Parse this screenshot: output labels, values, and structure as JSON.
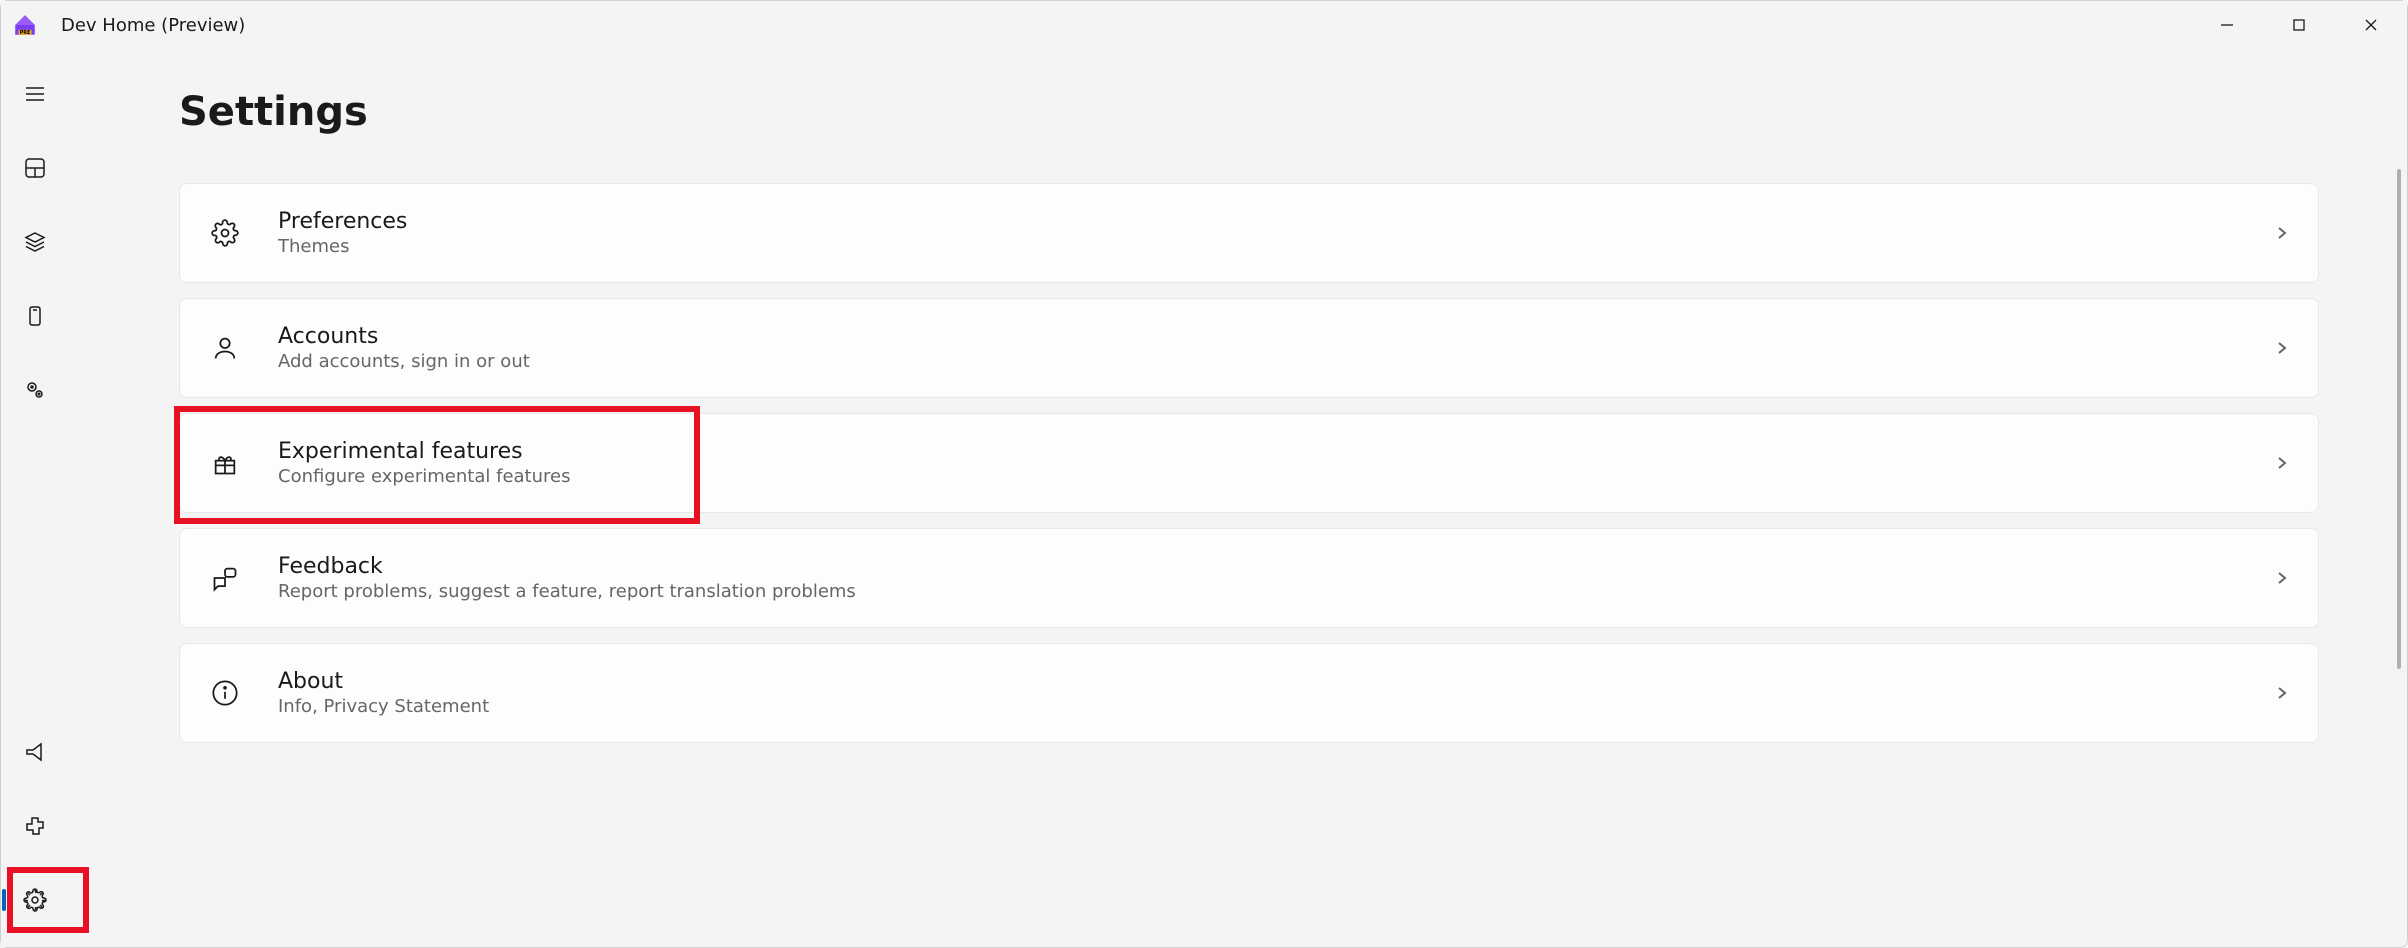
{
  "app": {
    "title": "Dev Home (Preview)"
  },
  "page": {
    "title": "Settings"
  },
  "cards": [
    {
      "id": "preferences",
      "title": "Preferences",
      "subtitle": "Themes",
      "icon": "gear"
    },
    {
      "id": "accounts",
      "title": "Accounts",
      "subtitle": "Add accounts, sign in or out",
      "icon": "person"
    },
    {
      "id": "experimental",
      "title": "Experimental features",
      "subtitle": "Configure experimental features",
      "icon": "gift",
      "highlighted": true
    },
    {
      "id": "feedback",
      "title": "Feedback",
      "subtitle": "Report problems, suggest a feature, report translation problems",
      "icon": "feedback"
    },
    {
      "id": "about",
      "title": "About",
      "subtitle": "Info, Privacy Statement",
      "icon": "info"
    }
  ],
  "sidebar_bottom_selected": "settings"
}
